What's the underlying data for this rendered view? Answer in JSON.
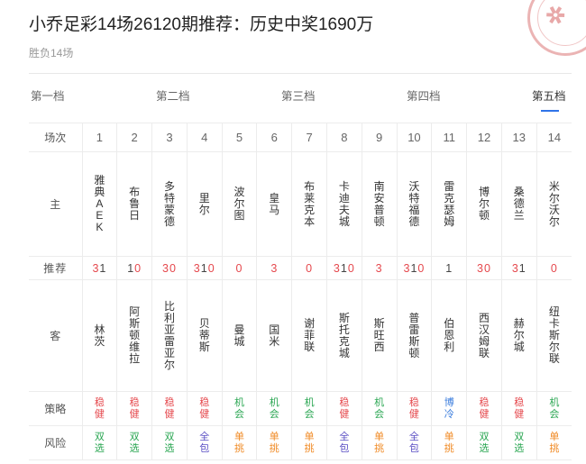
{
  "header": {
    "title": "小乔足彩14场26120期推荐：历史中奖1690万",
    "subtitle": "胜负14场"
  },
  "tabs": [
    {
      "label": "第一档",
      "active": false
    },
    {
      "label": "第二档",
      "active": false
    },
    {
      "label": "第三档",
      "active": false
    },
    {
      "label": "第四档",
      "active": false
    },
    {
      "label": "第五档",
      "active": true
    }
  ],
  "table": {
    "row_labels": {
      "num": "场次",
      "home": "主",
      "tip": "推荐",
      "away": "客",
      "strategy": "策略",
      "risk": "风险"
    },
    "matches": [
      {
        "num": "1",
        "home": "雅典AEK",
        "tip": "31",
        "away": "林茨",
        "strategy": "稳健",
        "risk": "双选"
      },
      {
        "num": "2",
        "home": "布鲁日",
        "tip": "10",
        "away": "阿斯顿维拉",
        "strategy": "稳健",
        "risk": "双选"
      },
      {
        "num": "3",
        "home": "多特蒙德",
        "tip": "30",
        "away": "比利亚雷亚尔",
        "strategy": "稳健",
        "risk": "双选"
      },
      {
        "num": "4",
        "home": "里尔",
        "tip": "310",
        "away": "贝蒂斯",
        "strategy": "稳健",
        "risk": "全包"
      },
      {
        "num": "5",
        "home": "波尔图",
        "tip": "0",
        "away": "曼城",
        "strategy": "机会",
        "risk": "单挑"
      },
      {
        "num": "6",
        "home": "皇马",
        "tip": "3",
        "away": "国米",
        "strategy": "机会",
        "risk": "单挑"
      },
      {
        "num": "7",
        "home": "布莱克本",
        "tip": "0",
        "away": "谢菲联",
        "strategy": "机会",
        "risk": "单挑"
      },
      {
        "num": "8",
        "home": "卡迪夫城",
        "tip": "310",
        "away": "斯托克城",
        "strategy": "稳健",
        "risk": "全包"
      },
      {
        "num": "9",
        "home": "南安普顿",
        "tip": "3",
        "away": "斯旺西",
        "strategy": "机会",
        "risk": "单挑"
      },
      {
        "num": "10",
        "home": "沃特福德",
        "tip": "310",
        "away": "普雷斯顿",
        "strategy": "稳健",
        "risk": "全包"
      },
      {
        "num": "11",
        "home": "雷克瑟姆",
        "tip": "1",
        "away": "伯恩利",
        "strategy": "博冷",
        "risk": "单挑"
      },
      {
        "num": "12",
        "home": "博尔顿",
        "tip": "30",
        "away": "西汉姆联",
        "strategy": "稳健",
        "risk": "双选"
      },
      {
        "num": "13",
        "home": "桑德兰",
        "tip": "31",
        "away": "赫尔城",
        "strategy": "稳健",
        "risk": "双选"
      },
      {
        "num": "14",
        "home": "米尔沃尔",
        "tip": "0",
        "away": "纽卡斯尔联",
        "strategy": "机会",
        "risk": "单挑"
      }
    ]
  },
  "colors": {
    "稳健": "#e5484d",
    "机会": "#2aa652",
    "博冷": "#3b7ddd",
    "双选": "#2aa652",
    "单挑": "#f08a24",
    "全包": "#5b4fc4",
    "accent": "#2f74e8"
  }
}
